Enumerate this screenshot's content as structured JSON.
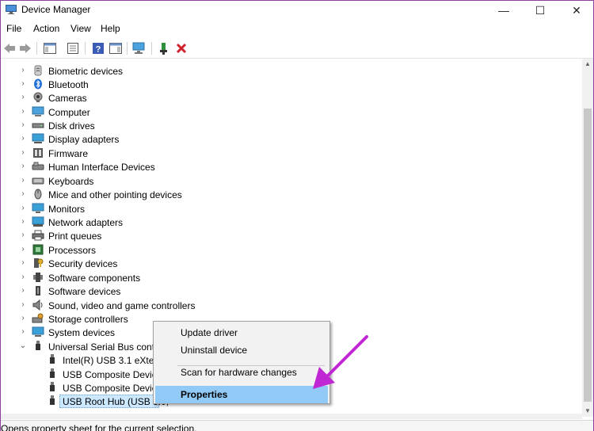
{
  "window": {
    "title": "Device Manager",
    "icon": "device-manager-icon",
    "controls": {
      "minimize": "—",
      "maximize": "☐",
      "close": "✕"
    }
  },
  "menu": [
    "File",
    "Action",
    "View",
    "Help"
  ],
  "toolbar": [
    "back-arrow-icon",
    "forward-arrow-icon",
    "show-hide-console-tree-icon",
    "properties-sheet-icon",
    "help-icon",
    "action-pane-icon",
    "scan-hardware-icon",
    "update-driver-icon",
    "uninstall-device-icon"
  ],
  "tree": {
    "categories": [
      {
        "label": "Biometric devices",
        "icon": "fingerprint-icon"
      },
      {
        "label": "Bluetooth",
        "icon": "bluetooth-icon"
      },
      {
        "label": "Cameras",
        "icon": "camera-icon"
      },
      {
        "label": "Computer",
        "icon": "computer-icon"
      },
      {
        "label": "Disk drives",
        "icon": "disk-drive-icon"
      },
      {
        "label": "Display adapters",
        "icon": "display-adapter-icon"
      },
      {
        "label": "Firmware",
        "icon": "firmware-icon"
      },
      {
        "label": "Human Interface Devices",
        "icon": "hid-icon"
      },
      {
        "label": "Keyboards",
        "icon": "keyboard-icon"
      },
      {
        "label": "Mice and other pointing devices",
        "icon": "mouse-icon"
      },
      {
        "label": "Monitors",
        "icon": "monitor-icon"
      },
      {
        "label": "Network adapters",
        "icon": "network-adapter-icon"
      },
      {
        "label": "Print queues",
        "icon": "printer-icon"
      },
      {
        "label": "Processors",
        "icon": "processor-icon"
      },
      {
        "label": "Security devices",
        "icon": "security-device-icon"
      },
      {
        "label": "Software components",
        "icon": "software-component-icon"
      },
      {
        "label": "Software devices",
        "icon": "software-device-icon"
      },
      {
        "label": "Sound, video and game controllers",
        "icon": "speaker-icon"
      },
      {
        "label": "Storage controllers",
        "icon": "storage-controller-icon"
      },
      {
        "label": "System devices",
        "icon": "system-device-icon"
      },
      {
        "label": "Universal Serial Bus contro",
        "icon": "usb-icon",
        "expanded": true
      }
    ],
    "usb_children": [
      {
        "label": "Intel(R) USB 3.1 eXtensi",
        "icon": "usb-plug-icon"
      },
      {
        "label": "USB Composite Device",
        "icon": "usb-plug-icon"
      },
      {
        "label": "USB Composite Device",
        "icon": "usb-plug-icon"
      },
      {
        "label": "USB Root Hub (USB 3.0,",
        "icon": "usb-plug-icon",
        "selected": true
      }
    ]
  },
  "context_menu": {
    "items": [
      {
        "label": "Update driver"
      },
      {
        "label": "Uninstall device"
      },
      {
        "label": "Scan for hardware changes"
      },
      {
        "label": "Properties",
        "highlighted": true
      }
    ]
  },
  "status_bar": {
    "text": "Opens property sheet for the current selection."
  },
  "colors": {
    "selection": "#cce8ff",
    "menu_highlight": "#91c9f7",
    "annotation_arrow": "#c026d3",
    "window_border": "#8f3fa0"
  }
}
